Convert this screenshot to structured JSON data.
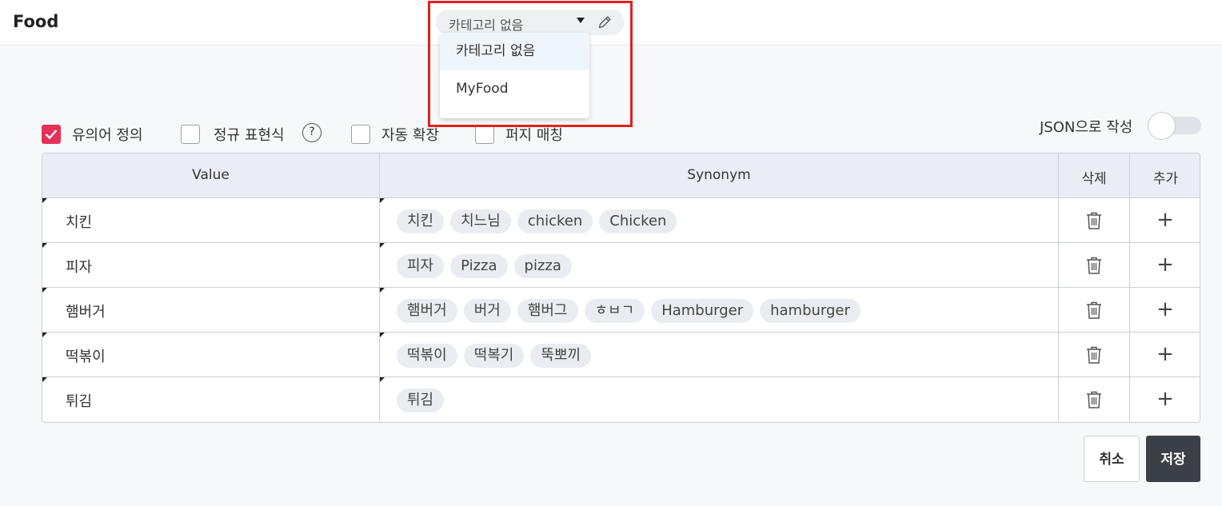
{
  "header": {
    "title": "Food",
    "category": {
      "selected": "카테고리 없음",
      "options": [
        "카테고리 없음",
        "MyFood"
      ]
    }
  },
  "options": {
    "synonym": {
      "label": "유의어 정의",
      "checked": true
    },
    "regex": {
      "label": "정규 표현식",
      "checked": false
    },
    "help": "?",
    "auto_expand": {
      "label": "자동 확장",
      "checked": false
    },
    "fuzzy": {
      "label": "퍼지 매칭",
      "checked": false
    },
    "json_toggle": {
      "label": "JSON으로 작성",
      "on": false
    }
  },
  "table": {
    "headers": {
      "value": "Value",
      "synonym": "Synonym",
      "delete": "삭제",
      "add": "추가"
    },
    "rows": [
      {
        "value": "치킨",
        "synonyms": [
          "치킨",
          "치느님",
          "chicken",
          "Chicken"
        ]
      },
      {
        "value": "피자",
        "synonyms": [
          "피자",
          "Pizza",
          "pizza"
        ]
      },
      {
        "value": "햄버거",
        "synonyms": [
          "햄버거",
          "버거",
          "햄버그",
          "ㅎㅂㄱ",
          "Hamburger",
          "hamburger"
        ]
      },
      {
        "value": "떡볶이",
        "synonyms": [
          "떡볶이",
          "떡복기",
          "뚝뽀끼"
        ]
      },
      {
        "value": "튀김",
        "synonyms": [
          "튀김"
        ]
      }
    ],
    "add_symbol": "+"
  },
  "buttons": {
    "cancel": "취소",
    "save": "저장"
  },
  "colors": {
    "accent": "#e5305a",
    "highlight": "#e0201d",
    "save_bg": "#3b3f46"
  }
}
